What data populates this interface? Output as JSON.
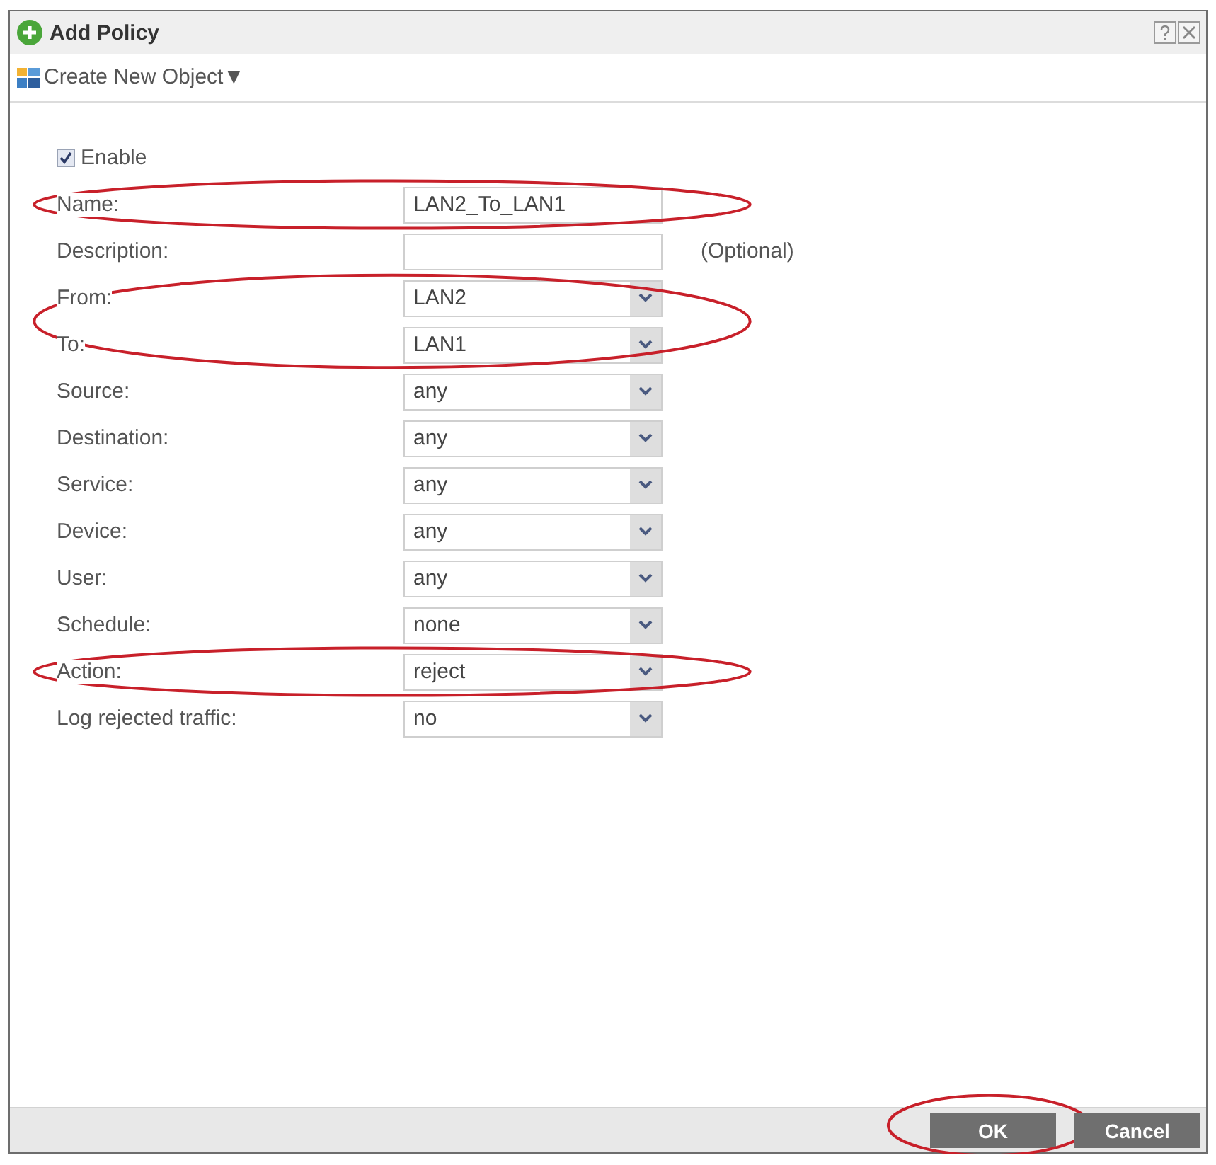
{
  "window": {
    "title": "Add Policy"
  },
  "toolbar": {
    "create_button": "Create New Object▼"
  },
  "enable": {
    "label": "Enable",
    "checked": true
  },
  "fields": [
    {
      "label": "Name:",
      "kind": "text",
      "value": "LAN2_To_LAN1",
      "circled": true
    },
    {
      "label": "Description:",
      "kind": "text",
      "note": "(Optional)",
      "circled": false
    },
    {
      "label": "From:",
      "kind": "select",
      "value": "LAN2",
      "circled": true
    },
    {
      "label": "To:",
      "kind": "select",
      "value": "LAN1",
      "circled": true
    },
    {
      "label": "Source:",
      "kind": "select",
      "value": "any",
      "circled": false
    },
    {
      "label": "Destination:",
      "kind": "select",
      "value": "any",
      "circled": false
    },
    {
      "label": "Service:",
      "kind": "select",
      "value": "any",
      "circled": false
    },
    {
      "label": "Device:",
      "kind": "select",
      "value": "any",
      "circled": false
    },
    {
      "label": "User:",
      "kind": "select",
      "value": "any",
      "circled": false
    },
    {
      "label": "Schedule:",
      "kind": "select",
      "value": "none",
      "circled": false
    },
    {
      "label": "Action:",
      "kind": "select",
      "value": "reject",
      "circled": true
    },
    {
      "label": "Log rejected traffic:",
      "kind": "select",
      "value": "no",
      "circled": false
    }
  ],
  "buttons": [
    {
      "label": "OK",
      "circled": true
    },
    {
      "label": "Cancel",
      "circled": false
    }
  ]
}
